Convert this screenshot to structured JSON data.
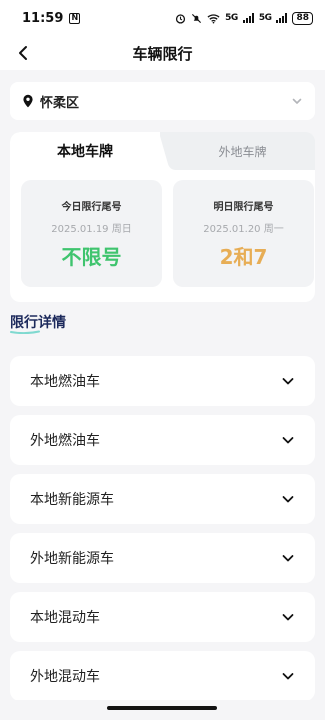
{
  "status_bar": {
    "time": "11:59",
    "nfc": "N",
    "signal_1": "5G",
    "signal_2": "5G",
    "battery": "88"
  },
  "nav": {
    "title": "车辆限行"
  },
  "location": {
    "name": "怀柔区"
  },
  "plate_tabs": {
    "local": "本地车牌",
    "foreign": "外地车牌"
  },
  "today": {
    "label": "今日限行尾号",
    "date": "2025.01.19 周日",
    "value": "不限号"
  },
  "tomorrow": {
    "label": "明日限行尾号",
    "date": "2025.01.20 周一",
    "value": "2和7"
  },
  "details": {
    "title": "限行详情",
    "items": [
      {
        "label": "本地燃油车"
      },
      {
        "label": "外地燃油车"
      },
      {
        "label": "本地新能源车"
      },
      {
        "label": "外地新能源车"
      },
      {
        "label": "本地混动车"
      },
      {
        "label": "外地混动车"
      }
    ]
  },
  "colors": {
    "green": "#3fc46e",
    "orange": "#e7ad55",
    "section_title": "#1d2a5c",
    "underline": "#7fd9d0"
  }
}
